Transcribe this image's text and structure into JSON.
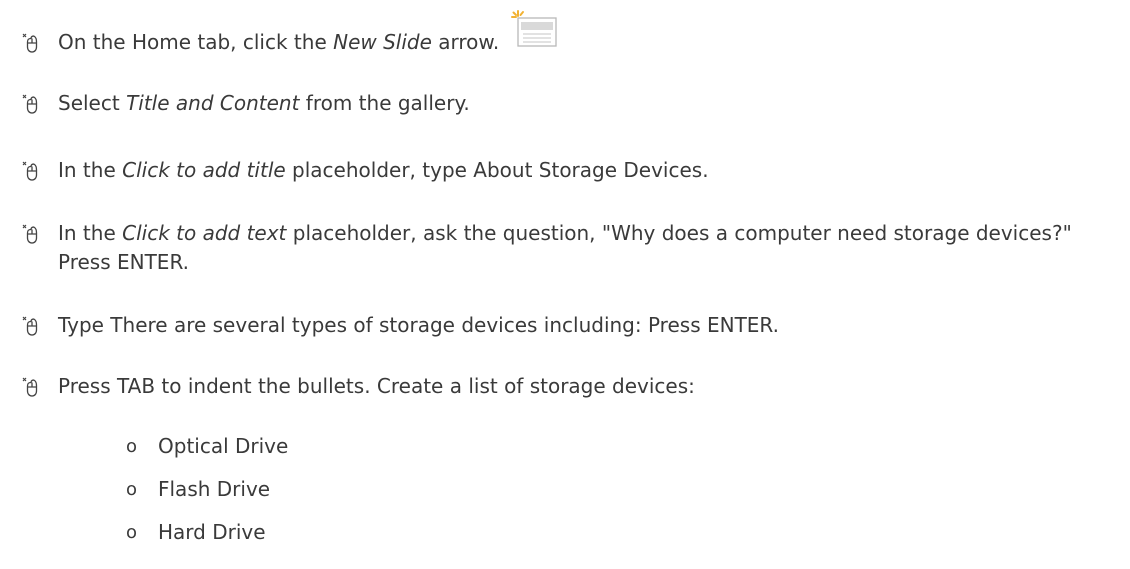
{
  "steps": [
    {
      "pre": "On the Home tab, click the ",
      "em": "New Slide",
      "post": " arrow."
    },
    {
      "pre": "Select ",
      "em": "Title and Content",
      "post": " from the gallery."
    },
    {
      "pre": "In the ",
      "em": "Click to add title",
      "post": " placeholder, type About Storage Devices."
    },
    {
      "pre": "In the ",
      "em": "Click to add text",
      "post": " placeholder, ask the question, \"Why does a computer need storage devices?\" Press ENTER."
    },
    {
      "text": "Type There are several types of storage devices including: Press ENTER."
    },
    {
      "text": "Press TAB to indent the bullets. Create a list of storage devices:"
    }
  ],
  "sub_items": [
    {
      "bullet": "o",
      "label": "Optical Drive"
    },
    {
      "bullet": "o",
      "label": "Flash Drive"
    },
    {
      "bullet": "o",
      "label": "Hard Drive"
    }
  ],
  "icons": {
    "step_icon": "mouse-click-icon",
    "new_slide_icon": "new-slide-icon"
  },
  "colors": {
    "text": "#3a3a3a",
    "accent": "#f2b233"
  }
}
